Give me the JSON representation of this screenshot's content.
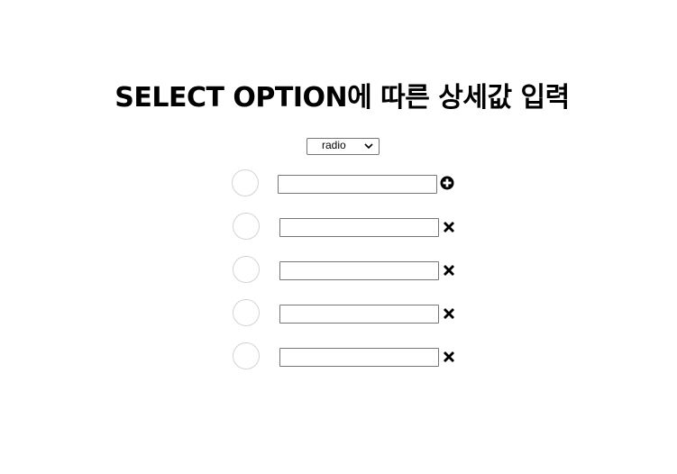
{
  "page": {
    "title": "SELECT OPTION에 따른 상세값 입력"
  },
  "select": {
    "value": "radio"
  },
  "options": [
    {
      "value": "",
      "action": "add",
      "icon": "plus-circle-icon"
    },
    {
      "value": "",
      "action": "remove",
      "icon": "close-icon"
    },
    {
      "value": "",
      "action": "remove",
      "icon": "close-icon"
    },
    {
      "value": "",
      "action": "remove",
      "icon": "close-icon"
    },
    {
      "value": "",
      "action": "remove",
      "icon": "close-icon"
    }
  ],
  "colors": {
    "radio_border": "#d3d3d3",
    "input_border": "#767676",
    "text": "#000000"
  }
}
